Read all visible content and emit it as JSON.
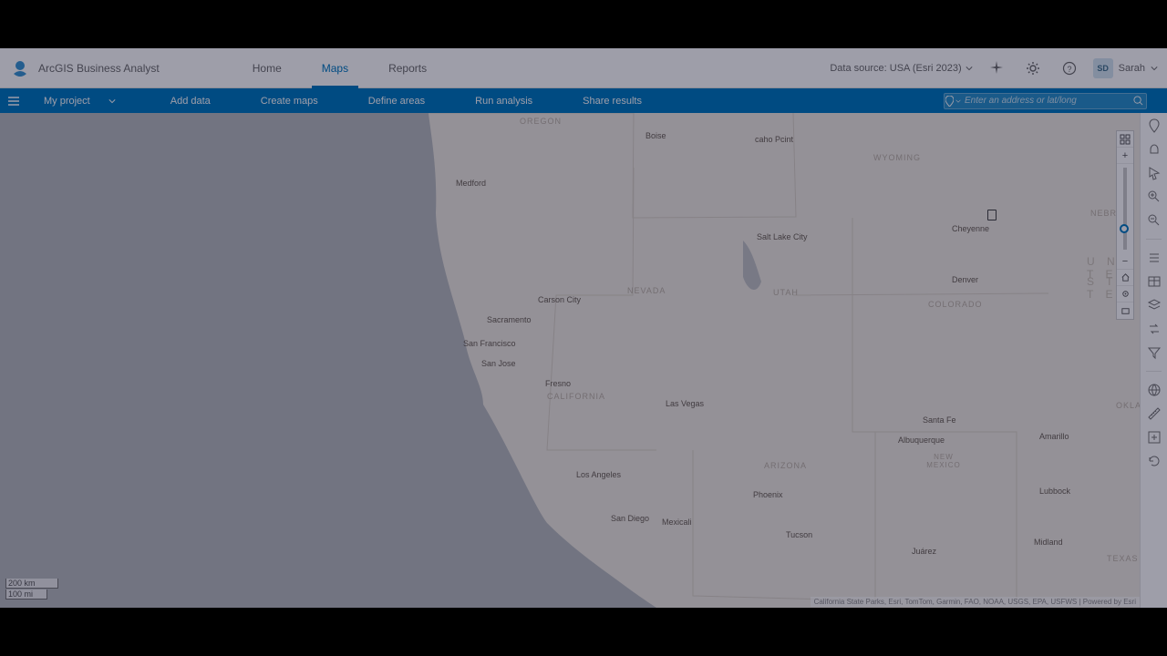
{
  "header": {
    "app_title": "ArcGIS Business Analyst",
    "nav": {
      "home": "Home",
      "maps": "Maps",
      "reports": "Reports"
    },
    "data_source_label": "Data source: USA (Esri 2023)",
    "user_initials": "SD",
    "user_name": "Sarah"
  },
  "toolbar": {
    "project_label": "My project",
    "links": {
      "add_data": "Add data",
      "create_maps": "Create maps",
      "define_areas": "Define areas",
      "run_analysis": "Run analysis",
      "share_results": "Share results"
    }
  },
  "search": {
    "placeholder": "Enter an address or lat/long"
  },
  "map": {
    "labels": {
      "oregon": "OREGON",
      "medford": "Medford",
      "boise": "Boise",
      "caho_point": "caho Pcint",
      "wyoming": "WYOMING",
      "cheyenne": "Cheyenne",
      "nebr": "NEBR",
      "salt_lake": "Salt Lake City",
      "utah": "UTAH",
      "nevada": "NEVADA",
      "carson_city": "Carson City",
      "sacramento": "Sacramento",
      "san_fran": "San Francisco",
      "san_jose": "San Jose",
      "fresno": "Fresno",
      "california": "CALIFORNIA",
      "las_vegas": "Las Vegas",
      "denver": "Denver",
      "colorado": "COLORADO",
      "united": "U N I T E D",
      "states": "S T A T E S",
      "santa_fe": "Santa Fe",
      "albuquerque": "Albuquerque",
      "new_mexico": "NEW MEXICO",
      "arizona": "ARIZONA",
      "los_angeles": "Los Angeles",
      "phoenix": "Phoenix",
      "san_diego": "San Diego",
      "mexicali": "Mexicali",
      "tucson": "Tucson",
      "juarez": "Juárez",
      "amarillo": "Amarillo",
      "lubbock": "Lubbock",
      "midland": "Midland",
      "oklah": "OKLAH",
      "texas": "TEXAS"
    },
    "scale": {
      "km": "200 km",
      "mi": "100 mi"
    },
    "attribution": "California State Parks, Esri, TomTom, Garmin, FAO, NOAA, USGS, EPA, USFWS  |  Powered by Esri"
  },
  "colors": {
    "brand_blue": "#0079c1"
  }
}
